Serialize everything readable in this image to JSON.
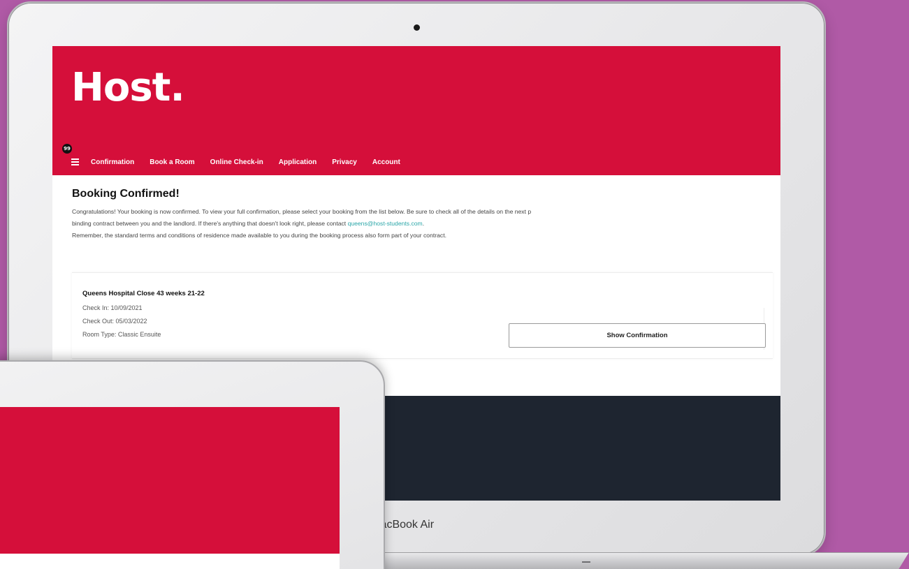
{
  "brand": {
    "logo_text": "Host.",
    "accent_color": "#d50f3a",
    "link_color": "#2aa6a8",
    "footer_color": "#1e2530",
    "background_color": "#b05aa6"
  },
  "nav": {
    "menu_icon": "hamburger-icon",
    "notification_count": "99",
    "items": [
      {
        "label": "Confirmation"
      },
      {
        "label": "Book a Room"
      },
      {
        "label": "Online Check-in"
      },
      {
        "label": "Application"
      },
      {
        "label": "Privacy"
      },
      {
        "label": "Account"
      }
    ]
  },
  "page": {
    "title": "Booking Confirmed!",
    "intro_line1": "Congratulations! Your booking is now confirmed. To view your full confirmation, please select your booking from the list below. Be sure to check all of the details on the next p",
    "intro_line2_prefix": "binding contract between you and the landlord. If there's anything that doesn't look right, please contact ",
    "contact_email": "queens@host-students.com",
    "intro_line2_suffix": ".",
    "intro_line3": "Remember, the standard terms and conditions of residence made available to you during the booking process also form part of your contract."
  },
  "booking": {
    "name": "Queens Hospital Close 43 weeks 21-22",
    "check_in": "Check In: 10/09/2021",
    "check_out": "Check Out: 05/03/2022",
    "room_type": "Room Type: Classic Ensuite",
    "button_label": "Show Confirmation"
  },
  "device": {
    "model_label": "lacBook Air"
  }
}
